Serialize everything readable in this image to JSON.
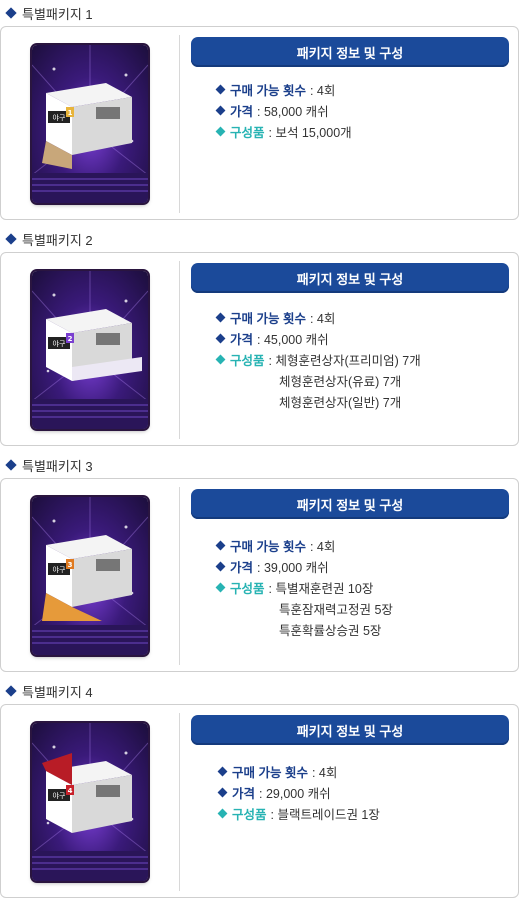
{
  "header_title": "패키지 정보 및 구성",
  "labels": {
    "count": "구매 가능 횟수",
    "price": "가격",
    "contents": "구성품"
  },
  "packages": [
    {
      "title": "특별패키지 1",
      "count": ": 4회",
      "price": ": 58,000 캐쉬",
      "contents": [
        ":  보석 15,000개"
      ],
      "badge": "1",
      "badge_color": "#e8b43a",
      "box_inside_color": "#c8a77a"
    },
    {
      "title": "특별패키지 2",
      "count": ": 4회",
      "price": ": 45,000 캐쉬",
      "contents": [
        ":  체형훈련상자(프리미엄) 7개",
        "체형훈련상자(유료) 7개",
        "체형훈련상자(일반) 7개"
      ],
      "badge": "2",
      "badge_color": "#7a3fd0",
      "box_inside_color": "#ece8f4"
    },
    {
      "title": "특별패키지 3",
      "count": ": 4회",
      "price": ": 39,000 캐쉬",
      "contents": [
        ":  특별재훈련권 10장",
        "특훈잠재력고정권 5장",
        "특훈확률상승권 5장"
      ],
      "badge": "3",
      "badge_color": "#e07a1f",
      "box_inside_color": "#e69a3a"
    },
    {
      "title": "특별패키지 4",
      "count": ": 4회",
      "price": ": 29,000 캐쉬",
      "contents": [
        ":  블랙트레이드권 1장"
      ],
      "badge": "4",
      "badge_color": "#c8202a",
      "box_inside_color": "#b81c26"
    }
  ],
  "colors": {
    "navy": "#1b3f8b",
    "pill": "#1b4a9a",
    "teal": "#27b3b3"
  },
  "icons": [
    "diamond-bullet-icon",
    "package-box-image"
  ]
}
